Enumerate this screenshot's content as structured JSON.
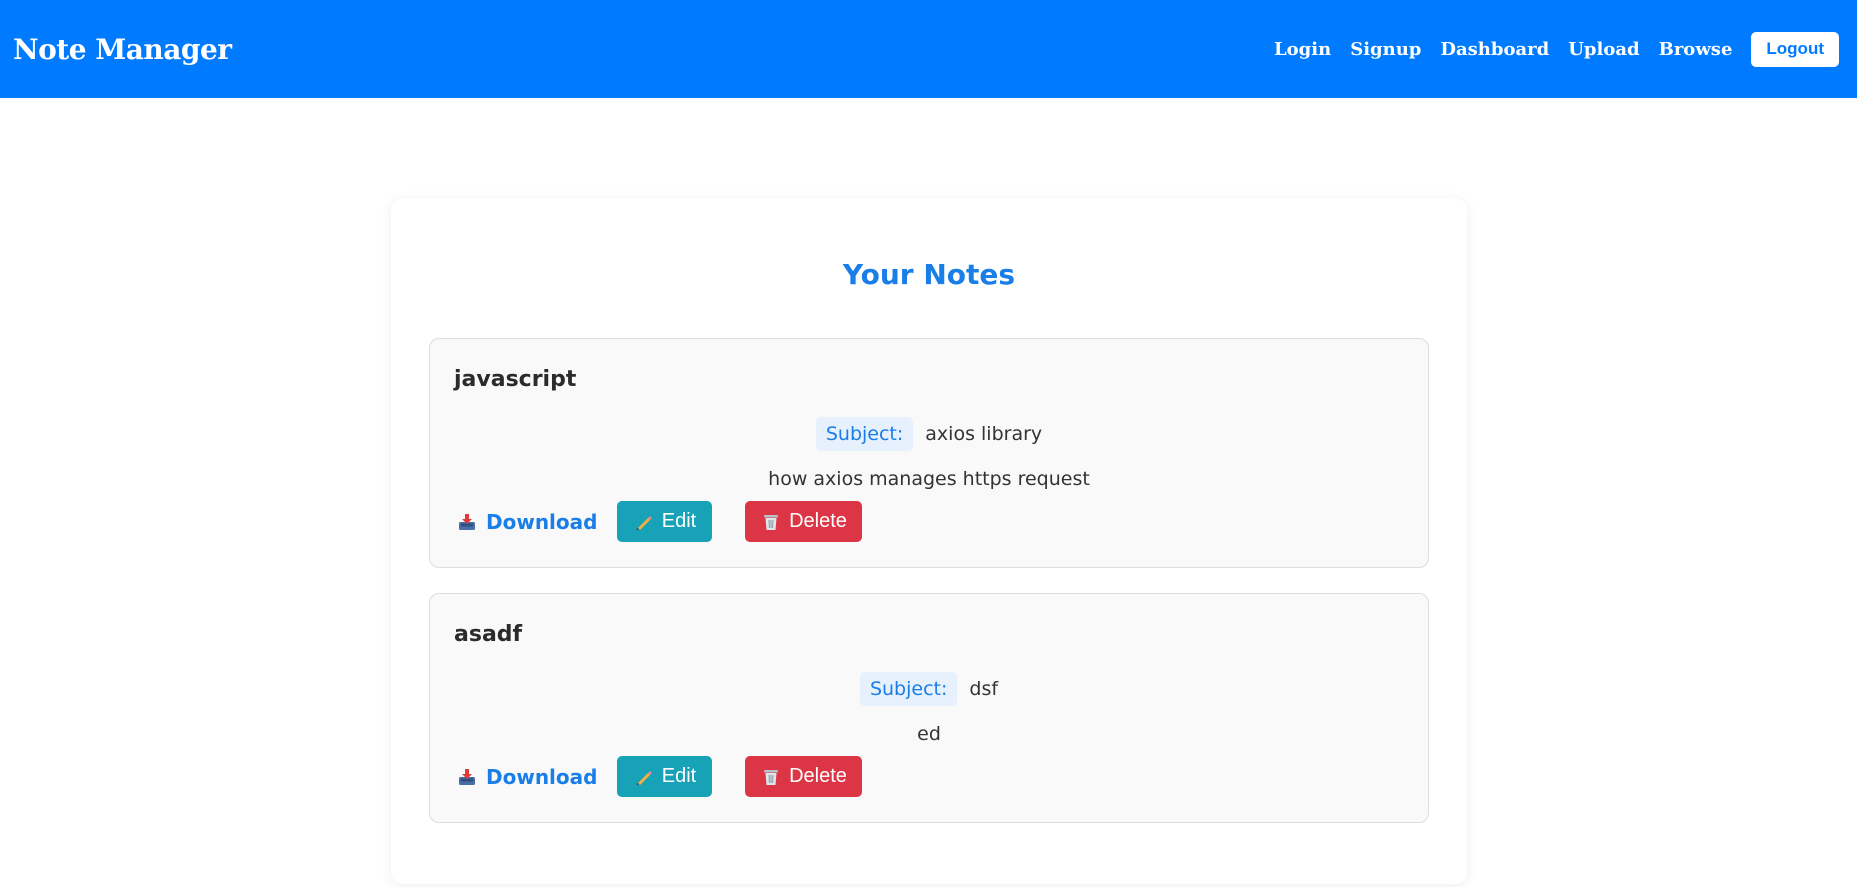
{
  "navbar": {
    "brand": "Note Manager",
    "links": [
      "Login",
      "Signup",
      "Dashboard",
      "Upload",
      "Browse"
    ],
    "logout_label": "Logout",
    "color": "#007bff"
  },
  "main": {
    "title": "Your Notes",
    "notes": [
      {
        "title": "javascript",
        "subject_label": "Subject:",
        "subject": "axios library",
        "description": "how axios manages https request",
        "download_label": "Download",
        "edit_label": "Edit",
        "delete_label": "Delete"
      },
      {
        "title": "asadf",
        "subject_label": "Subject:",
        "subject": "dsf",
        "description": "ed",
        "download_label": "Download",
        "edit_label": "Edit",
        "delete_label": "Delete"
      }
    ]
  },
  "colors": {
    "accent": "#1a7ee8",
    "edit": "#17a2b8",
    "delete": "#dc3545"
  },
  "icons": {
    "download": "inbox-tray-icon",
    "edit": "pencil-icon",
    "delete": "wastebasket-icon"
  }
}
